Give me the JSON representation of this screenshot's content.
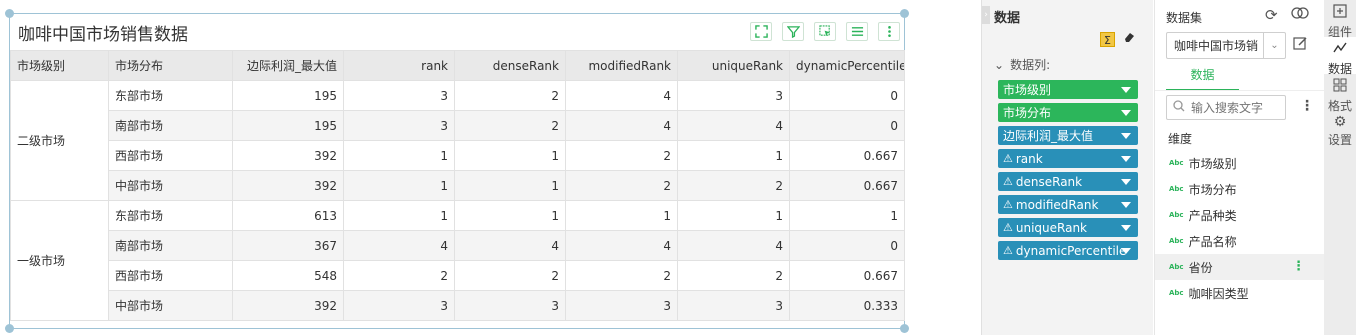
{
  "widget": {
    "title": "咖啡中国市场销售数据",
    "toolbar": [
      "expand-icon",
      "filter-icon",
      "select-icon",
      "list-icon",
      "more-icon"
    ]
  },
  "table": {
    "headers": [
      "市场级别",
      "市场分布",
      "边际利润_最大值",
      "rank",
      "denseRank",
      "modifiedRank",
      "uniqueRank",
      "dynamicPercentile"
    ],
    "groups": [
      {
        "level": "二级市场",
        "rows": [
          {
            "region": "东部市场",
            "values": [
              "195",
              "3",
              "2",
              "4",
              "3",
              "0"
            ]
          },
          {
            "region": "南部市场",
            "values": [
              "195",
              "3",
              "2",
              "4",
              "4",
              "0"
            ]
          },
          {
            "region": "西部市场",
            "values": [
              "392",
              "1",
              "1",
              "2",
              "1",
              "0.667"
            ]
          },
          {
            "region": "中部市场",
            "values": [
              "392",
              "1",
              "1",
              "2",
              "2",
              "0.667"
            ]
          }
        ]
      },
      {
        "level": "一级市场",
        "rows": [
          {
            "region": "东部市场",
            "values": [
              "613",
              "1",
              "1",
              "1",
              "1",
              "1"
            ]
          },
          {
            "region": "南部市场",
            "values": [
              "367",
              "4",
              "4",
              "4",
              "4",
              "0"
            ]
          },
          {
            "region": "西部市场",
            "values": [
              "548",
              "2",
              "2",
              "2",
              "2",
              "0.667"
            ]
          },
          {
            "region": "中部市场",
            "values": [
              "392",
              "3",
              "3",
              "3",
              "3",
              "0.333"
            ]
          }
        ]
      }
    ]
  },
  "data_panel": {
    "title": "数据",
    "columns_label": "数据列:",
    "fields": [
      {
        "label": "市场级别",
        "type": "dimension"
      },
      {
        "label": "市场分布",
        "type": "dimension"
      },
      {
        "label": "边际利润_最大值",
        "type": "measure"
      },
      {
        "label": "rank",
        "type": "measure"
      },
      {
        "label": "denseRank",
        "type": "measure"
      },
      {
        "label": "modifiedRank",
        "type": "measure"
      },
      {
        "label": "uniqueRank",
        "type": "measure"
      },
      {
        "label": "dynamicPercentile",
        "type": "measure"
      }
    ],
    "colors": {
      "dimension": "#2cb65b",
      "measure": "#2990b8"
    }
  },
  "dataset": {
    "title": "数据集",
    "selected": "咖啡中国市场销",
    "tab": "数据",
    "search_placeholder": "输入搜索文字",
    "dimension_label": "维度",
    "dimensions": [
      "市场级别",
      "市场分布",
      "产品种类",
      "产品名称",
      "省份",
      "咖啡因类型"
    ],
    "abc_badge": "Abc"
  },
  "right_tabs": [
    {
      "label": "组件",
      "icon": "component-icon"
    },
    {
      "label": "数据",
      "icon": "data-icon"
    },
    {
      "label": "格式",
      "icon": "format-icon"
    },
    {
      "label": "设置",
      "icon": "settings-icon"
    }
  ],
  "accent": "#2bb35a"
}
